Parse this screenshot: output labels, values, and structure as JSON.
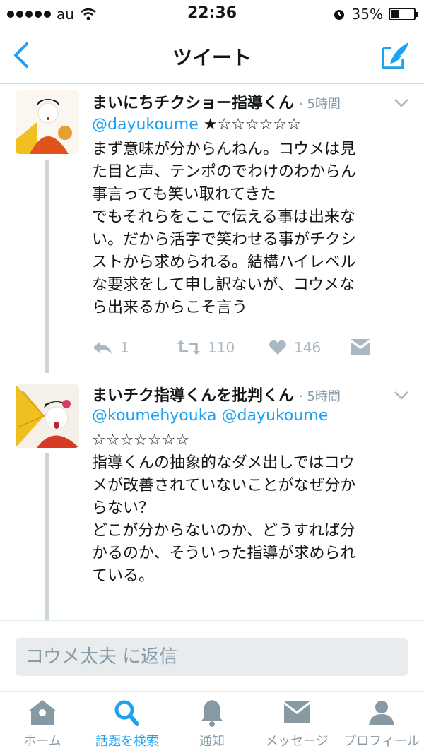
{
  "status_bar": {
    "carrier": "au",
    "time": "22:36",
    "battery": "35%",
    "battery_level": 0.35
  },
  "nav": {
    "title": "ツイート"
  },
  "tweets": [
    {
      "name": "まいにちチクショー指導くん",
      "time": "· 5時間",
      "handle": "@dayukoume",
      "stars": "★☆☆☆☆☆☆",
      "text": "まず意味が分からんねん。コウメは見\nた目と声、テンポのでわけのわからん\n事言っても笑い取れてきた\nでもそれらをここで伝える事は出来な\nい。だから活字で笑わせる事がチクシ\nストから求められる。結構ハイレベル\nな要求をして申し訳ないが、コウメな\nら出来るからこそ言う",
      "replies": "1",
      "retweets": "110",
      "likes": "146"
    },
    {
      "name": "まいチク指導くんを批判くん",
      "time": "· 5時間",
      "handle": "@koumehyouka",
      "mention": "@dayukoume",
      "stars": "☆☆☆☆☆☆☆",
      "text": "指導くんの抽象的なダメ出しではコウ\nメが改善されていないことがなぜ分か\nらない？\nどこが分からないのか、どうすれば分\nかるのか、そういった指導が求められ\nている。"
    }
  ],
  "reply": {
    "placeholder": "コウメ太夫 に返信"
  },
  "tabs": [
    {
      "label": "ホーム",
      "icon": "home-icon"
    },
    {
      "label": "話題を検索",
      "icon": "search-icon"
    },
    {
      "label": "通知",
      "icon": "bell-icon"
    },
    {
      "label": "メッセージ",
      "icon": "envelope-icon"
    },
    {
      "label": "プロフィール",
      "icon": "person-icon"
    }
  ],
  "colors": {
    "accent": "#1da1f2",
    "muted": "#8899a6",
    "icon_gray": "#aab8c2"
  }
}
